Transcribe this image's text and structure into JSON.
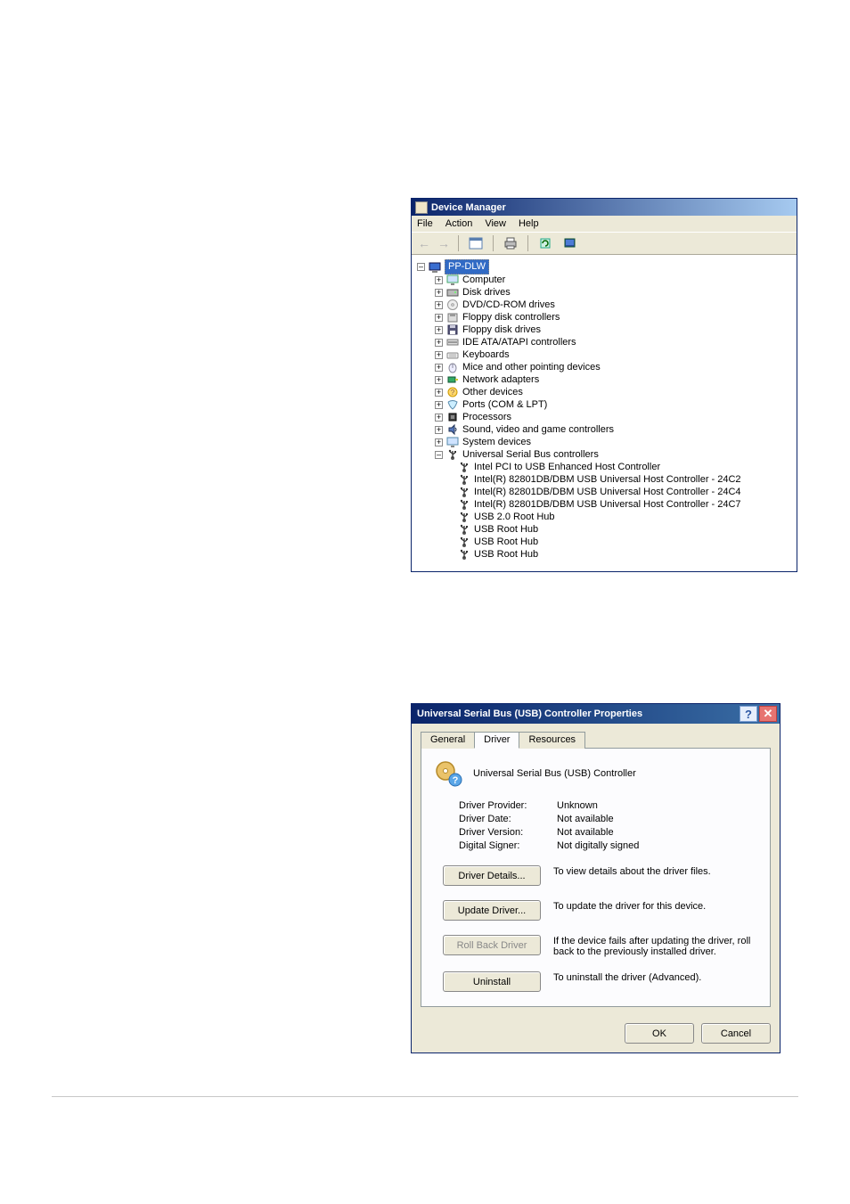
{
  "device_manager": {
    "title": "Device Manager",
    "menu": {
      "file": "File",
      "action": "Action",
      "view": "View",
      "help": "Help"
    },
    "root_node": "PP-DLW",
    "categories": [
      {
        "label": "Computer",
        "icon": "monitor"
      },
      {
        "label": "Disk drives",
        "icon": "disk"
      },
      {
        "label": "DVD/CD-ROM drives",
        "icon": "cd"
      },
      {
        "label": "Floppy disk controllers",
        "icon": "floppctrl"
      },
      {
        "label": "Floppy disk drives",
        "icon": "floppy"
      },
      {
        "label": "IDE ATA/ATAPI controllers",
        "icon": "ide"
      },
      {
        "label": "Keyboards",
        "icon": "kbd"
      },
      {
        "label": "Mice and other pointing devices",
        "icon": "mouse"
      },
      {
        "label": "Network adapters",
        "icon": "net"
      },
      {
        "label": "Other devices",
        "icon": "other"
      },
      {
        "label": "Ports (COM & LPT)",
        "icon": "port"
      },
      {
        "label": "Processors",
        "icon": "cpu"
      },
      {
        "label": "Sound, video and game controllers",
        "icon": "sound"
      },
      {
        "label": "System devices",
        "icon": "sys"
      }
    ],
    "usb_category": "Universal Serial Bus controllers",
    "usb_children": [
      "Intel PCI to USB Enhanced Host Controller",
      "Intel(R) 82801DB/DBM USB Universal Host Controller - 24C2",
      "Intel(R) 82801DB/DBM USB Universal Host Controller - 24C4",
      "Intel(R) 82801DB/DBM USB Universal Host Controller - 24C7",
      "USB 2.0 Root Hub",
      "USB Root Hub",
      "USB Root Hub",
      "USB Root Hub"
    ]
  },
  "properties": {
    "title": "Universal Serial Bus (USB) Controller Properties",
    "tabs": {
      "general": "General",
      "driver": "Driver",
      "resources": "Resources"
    },
    "device_name": "Universal Serial Bus (USB) Controller",
    "fields": {
      "provider_k": "Driver Provider:",
      "provider_v": "Unknown",
      "date_k": "Driver Date:",
      "date_v": "Not available",
      "version_k": "Driver Version:",
      "version_v": "Not available",
      "signer_k": "Digital Signer:",
      "signer_v": "Not digitally signed"
    },
    "buttons": {
      "details": "Driver Details...",
      "details_desc": "To view details about the driver files.",
      "update": "Update Driver...",
      "update_desc": "To update the driver for this device.",
      "rollback": "Roll Back Driver",
      "rollback_desc": "If the device fails after updating the driver, roll back to the previously installed driver.",
      "uninstall": "Uninstall",
      "uninstall_desc": "To uninstall the driver (Advanced)."
    },
    "footer": {
      "ok": "OK",
      "cancel": "Cancel"
    }
  }
}
